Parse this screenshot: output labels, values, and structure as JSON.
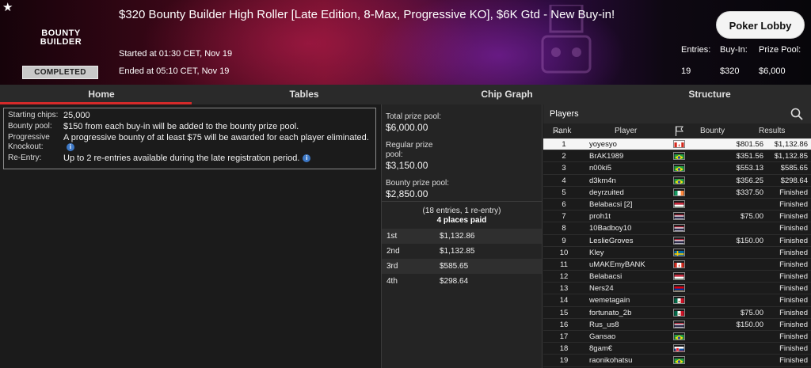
{
  "header": {
    "title": "$320 Bounty Builder High Roller [Late Edition, 8-Max, Progressive KO], $6K Gtd - New Buy-in!",
    "logo_line1": "BOUNTY",
    "logo_line2": "BUILDER",
    "status": "COMPLETED",
    "started": "Started at 01:30 CET, Nov 19",
    "ended": "Ended at 05:10 CET, Nov 19",
    "lobby_button": "Poker Lobby",
    "entries_label": "Entries:",
    "entries_value": "19",
    "buyin_label": "Buy-In:",
    "buyin_value": "$320",
    "prizepool_label": "Prize Pool:",
    "prizepool_value": "$6,000"
  },
  "tabs": [
    {
      "label": "Home",
      "active": true
    },
    {
      "label": "Tables",
      "active": false
    },
    {
      "label": "Chip Graph",
      "active": false
    },
    {
      "label": "Structure",
      "active": false
    }
  ],
  "info": [
    {
      "label": "Starting chips:",
      "value": "25,000"
    },
    {
      "label": "Bounty pool:",
      "value": "$150 from each buy-in will be added to the bounty prize pool."
    },
    {
      "label": "Progressive Knockout:",
      "value": "A progressive bounty of at least $75 will be awarded for each player eliminated."
    },
    {
      "label": "Re-Entry:",
      "value": "Up to 2 re-entries available during the late registration period."
    }
  ],
  "prize": {
    "total_label": "Total prize pool:",
    "total_value": "$6,000.00",
    "regular_label": "Regular prize pool:",
    "regular_value": "$3,150.00",
    "bounty_label": "Bounty prize pool:",
    "bounty_value": "$2,850.00",
    "entries_note": "(18 entries, 1 re-entry)",
    "places_paid": "4 places paid",
    "payouts": [
      {
        "place": "1st",
        "amount": "$1,132.86"
      },
      {
        "place": "2nd",
        "amount": "$1,132.85"
      },
      {
        "place": "3rd",
        "amount": "$585.65"
      },
      {
        "place": "4th",
        "amount": "$298.64"
      }
    ]
  },
  "players": {
    "title": "Players",
    "columns": {
      "rank": "Rank",
      "player": "Player",
      "bounty": "Bounty",
      "results": "Results"
    },
    "rows": [
      {
        "rank": "1",
        "name": "yoyesyo",
        "flag": "canada",
        "bounty": "$801.56",
        "result": "$1,132.86"
      },
      {
        "rank": "2",
        "name": "BrAK1989",
        "flag": "brazil",
        "bounty": "$351.56",
        "result": "$1,132.85"
      },
      {
        "rank": "3",
        "name": "n00ki5",
        "flag": "brazil",
        "bounty": "$553.13",
        "result": "$585.65"
      },
      {
        "rank": "4",
        "name": "d3km4n",
        "flag": "brazil",
        "bounty": "$356.25",
        "result": "$298.64"
      },
      {
        "rank": "5",
        "name": "deyrzuited",
        "flag": "ireland",
        "bounty": "$337.50",
        "result": "Finished"
      },
      {
        "rank": "6",
        "name": "Belabacsi [2]",
        "flag": "hungary",
        "bounty": "",
        "result": "Finished"
      },
      {
        "rank": "7",
        "name": "proh1t",
        "flag": "thailand",
        "bounty": "$75.00",
        "result": "Finished"
      },
      {
        "rank": "8",
        "name": "10Badboy10",
        "flag": "thailand",
        "bounty": "",
        "result": "Finished"
      },
      {
        "rank": "9",
        "name": "LeslieGroves",
        "flag": "thailand",
        "bounty": "$150.00",
        "result": "Finished"
      },
      {
        "rank": "10",
        "name": "Kley",
        "flag": "sweden",
        "bounty": "",
        "result": "Finished"
      },
      {
        "rank": "11",
        "name": "uMAKEmyBANK",
        "flag": "canada",
        "bounty": "",
        "result": "Finished"
      },
      {
        "rank": "12",
        "name": "Belabacsi",
        "flag": "hungary",
        "bounty": "",
        "result": "Finished"
      },
      {
        "rank": "13",
        "name": "Ners24",
        "flag": "armenia",
        "bounty": "",
        "result": "Finished"
      },
      {
        "rank": "14",
        "name": "wemetagain",
        "flag": "mexico",
        "bounty": "",
        "result": "Finished"
      },
      {
        "rank": "15",
        "name": "fortunato_2b",
        "flag": "mexico",
        "bounty": "$75.00",
        "result": "Finished"
      },
      {
        "rank": "16",
        "name": "Rus_us8",
        "flag": "thailand",
        "bounty": "$150.00",
        "result": "Finished"
      },
      {
        "rank": "17",
        "name": "Gansao",
        "flag": "brazil",
        "bounty": "",
        "result": "Finished"
      },
      {
        "rank": "18",
        "name": "8gam€",
        "flag": "slovakia",
        "bounty": "",
        "result": "Finished"
      },
      {
        "rank": "19",
        "name": "raonikohatsu",
        "flag": "brazil",
        "bounty": "",
        "result": "Finished"
      }
    ]
  },
  "colors": {
    "tab_active_underline": "#d42a2a",
    "info_icon": "#3d78c6",
    "badge": "#c9c9c9"
  }
}
